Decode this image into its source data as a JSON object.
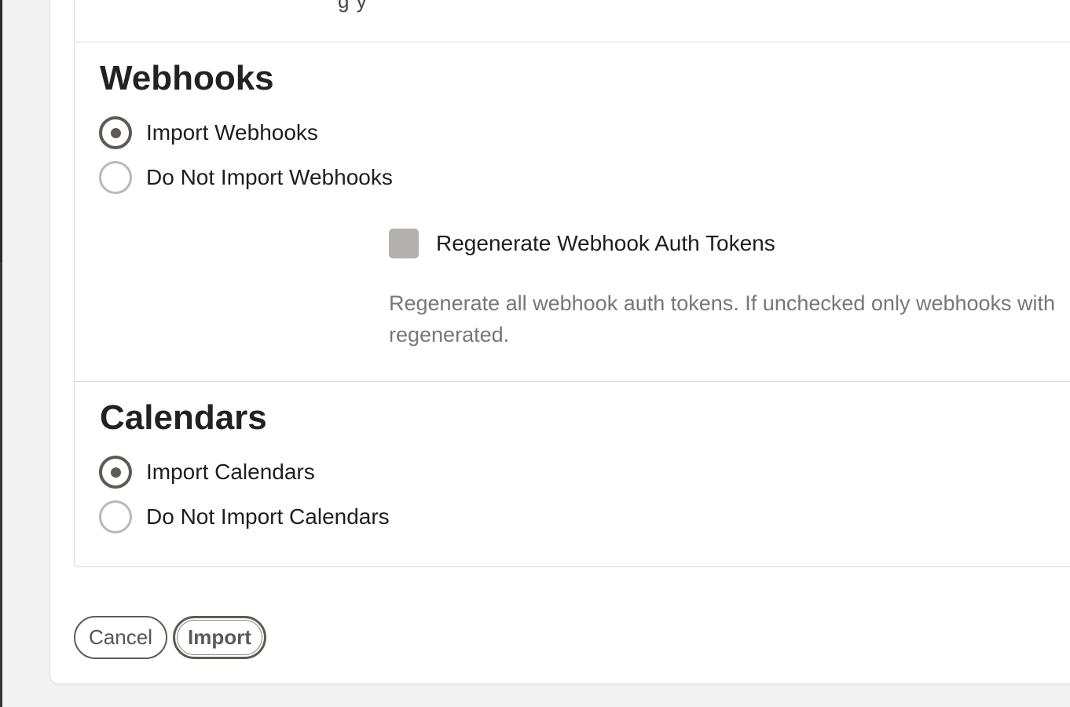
{
  "top_cut_text": "g        y",
  "webhooks": {
    "title": "Webhooks",
    "options": [
      {
        "label": "Import Webhooks",
        "selected": true
      },
      {
        "label": "Do Not Import Webhooks",
        "selected": false
      }
    ],
    "regenerate_checkbox": {
      "label": "Regenerate Webhook Auth Tokens",
      "checked": false
    },
    "help_line1": "Regenerate all webhook auth tokens. If unchecked only webhooks with",
    "help_line2": "regenerated."
  },
  "calendars": {
    "title": "Calendars",
    "options": [
      {
        "label": "Import Calendars",
        "selected": true
      },
      {
        "label": "Do Not Import Calendars",
        "selected": false
      }
    ]
  },
  "buttons": {
    "cancel": "Cancel",
    "import": "Import"
  },
  "colors": {
    "accent": "#5f5a55",
    "checkbox_fill": "#b3b0ad",
    "help_text": "#777777",
    "page_bg": "#f3f3f3"
  }
}
